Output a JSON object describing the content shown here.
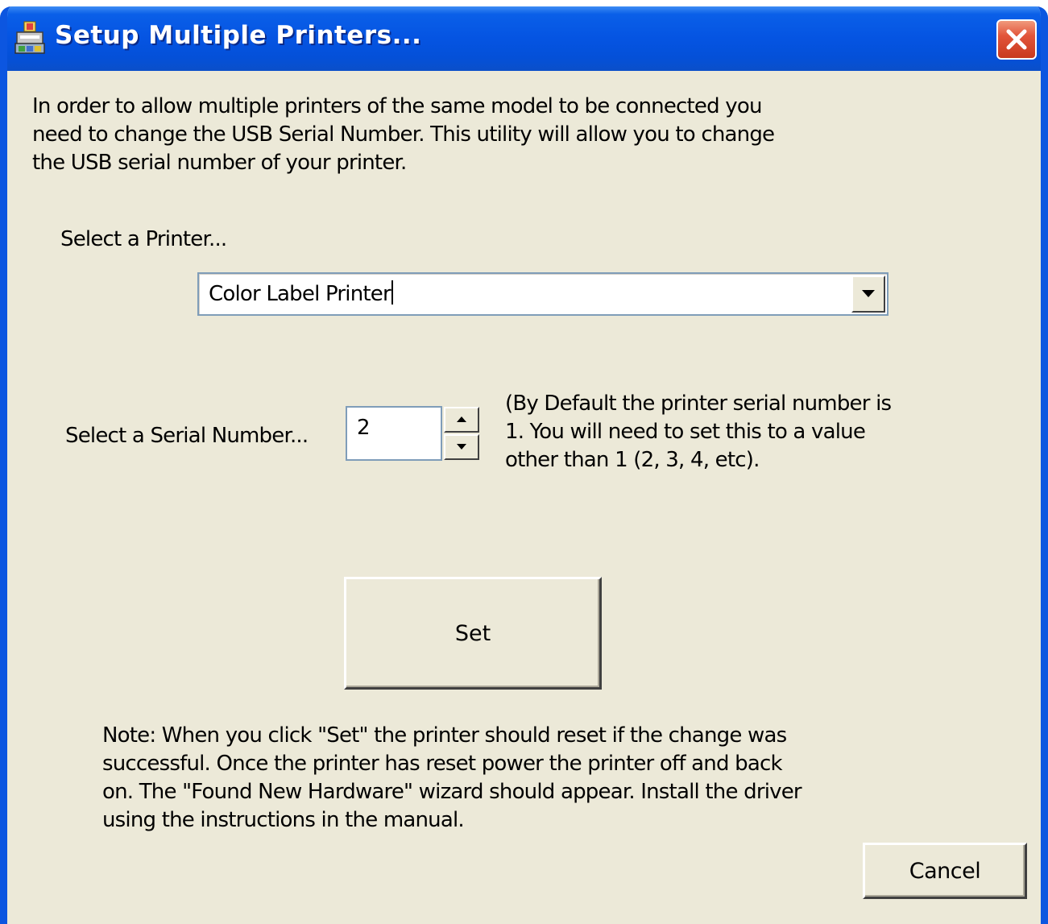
{
  "window": {
    "title": "Setup Multiple Printers...",
    "app_icon": "printer-setup-icon",
    "close_icon": "close-icon",
    "titlebar_color": "#0554e2",
    "body_color": "#ece9d8",
    "close_color": "#e2553a"
  },
  "intro": {
    "lines": [
      "In order to allow multiple printers of the same model to be connected you",
      "need to change the USB Serial Number.  This utility will allow you to change",
      "the USB serial number of your printer."
    ]
  },
  "printer": {
    "label": "Select a Printer...",
    "selected": "Color Label Printer",
    "dropdown_icon": "chevron-down-icon"
  },
  "serial": {
    "label": "Select a Serial Number...",
    "value": "2",
    "up_icon": "spin-up-icon",
    "down_icon": "spin-down-icon",
    "hint_lines": [
      "(By Default the printer serial number is",
      "1.  You will need to set this to a value",
      "other than 1 (2, 3, 4, etc)."
    ]
  },
  "set_button": {
    "label": "Set"
  },
  "note": {
    "lines": [
      "Note:  When you click \"Set\" the printer should reset if the change was",
      "successful.  Once the printer has reset power the printer off and back",
      "on. The \"Found New Hardware\" wizard should appear.  Install the driver",
      "using the instructions in the manual."
    ]
  },
  "cancel_button": {
    "label": "Cancel"
  }
}
